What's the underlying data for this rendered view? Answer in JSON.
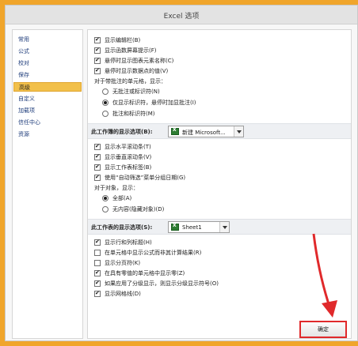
{
  "window": {
    "title": "Excel 选项"
  },
  "sidebar": {
    "items": [
      {
        "label": "常用",
        "active": false
      },
      {
        "label": "公式",
        "active": false
      },
      {
        "label": "校对",
        "active": false
      },
      {
        "label": "保存",
        "active": false
      },
      {
        "label": "高级",
        "active": true
      },
      {
        "label": "自定义",
        "active": false
      },
      {
        "label": "加载项",
        "active": false
      },
      {
        "label": "信任中心",
        "active": false
      },
      {
        "label": "资源",
        "active": false
      }
    ]
  },
  "top_options": {
    "show_formula_bar": {
      "label": "显示编辑栏(B)",
      "checked": true
    },
    "show_function_tips": {
      "label": "显示函数屏幕提示(F)",
      "checked": true
    },
    "show_chart_element_names": {
      "label": "悬停时显示图表元素名称(C)",
      "checked": true
    },
    "show_data_point_values": {
      "label": "悬停时显示数据点的值(V)",
      "checked": true
    },
    "comments_heading": "对于带批注的单元格，显示：",
    "comment_none": {
      "label": "无批注或标识符(N)",
      "selected": false
    },
    "comment_indicators": {
      "label": "仅显示标识符，悬停时加显批注(I)",
      "selected": true
    },
    "comment_all": {
      "label": "批注和标识符(M)",
      "selected": false
    }
  },
  "workbook_section": {
    "title": "此工作簿的显示选项(B):",
    "combo_value": "新建 Microsoft...",
    "show_hscroll": {
      "label": "显示水平滚动条(T)",
      "checked": true
    },
    "show_vscroll": {
      "label": "显示垂直滚动条(V)",
      "checked": true
    },
    "show_sheet_tabs": {
      "label": "显示工作表标签(B)",
      "checked": true
    },
    "group_dates": {
      "label": "使用“自动筛选”菜单分组日期(G)",
      "checked": true
    },
    "objects_heading": "对于对象，显示：",
    "objects_all": {
      "label": "全部(A)",
      "selected": true
    },
    "objects_nothing": {
      "label": "无内容(隐藏对象)(D)",
      "selected": false
    }
  },
  "sheet_section": {
    "title": "此工作表的显示选项(S):",
    "combo_value": "Sheet1",
    "show_headers": {
      "label": "显示行和列标题(H)",
      "checked": true
    },
    "show_formulas": {
      "label": "在单元格中显示公式而非其计算结果(R)",
      "checked": false
    },
    "show_page_breaks": {
      "label": "显示分页符(K)",
      "checked": false
    },
    "show_zero": {
      "label": "在具有零值的单元格中显示零(Z)",
      "checked": true
    },
    "show_outline": {
      "label": "如果应用了分级显示，则显示分级显示符号(O)",
      "checked": true
    },
    "show_gridlines": {
      "label": "显示网格线(D)",
      "checked": true
    }
  },
  "footer": {
    "ok_label": "确定"
  }
}
